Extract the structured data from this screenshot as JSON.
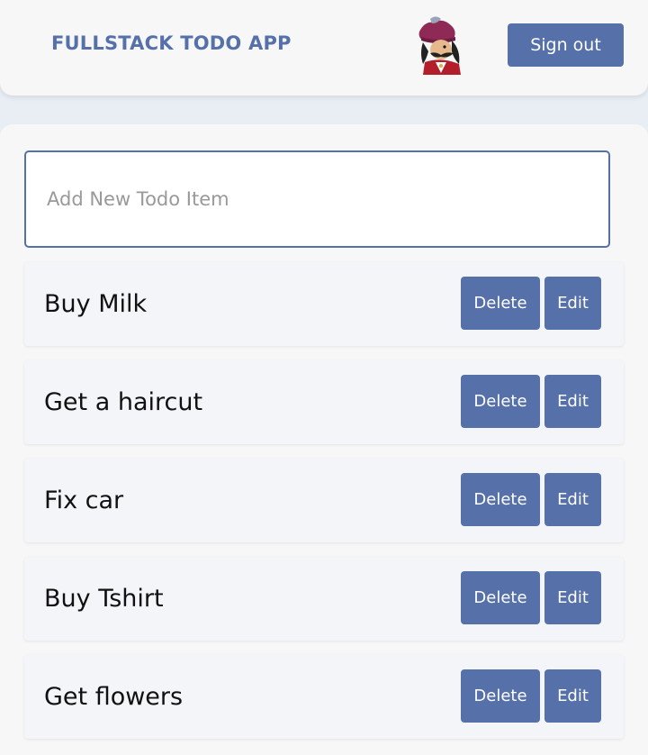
{
  "header": {
    "title": "FULLSTACK TODO APP",
    "avatar_icon": "pirate-captain-avatar",
    "signout_label": "Sign out"
  },
  "main": {
    "input_placeholder": "Add New Todo Item",
    "delete_label": "Delete",
    "edit_label": "Edit",
    "todos": [
      {
        "text": "Buy Milk"
      },
      {
        "text": "Get a haircut"
      },
      {
        "text": "Fix car"
      },
      {
        "text": "Buy Tshirt"
      },
      {
        "text": "Get flowers"
      }
    ]
  },
  "colors": {
    "accent": "#5670aa",
    "background": "#e9eef5",
    "panel": "#f7f7f8"
  }
}
